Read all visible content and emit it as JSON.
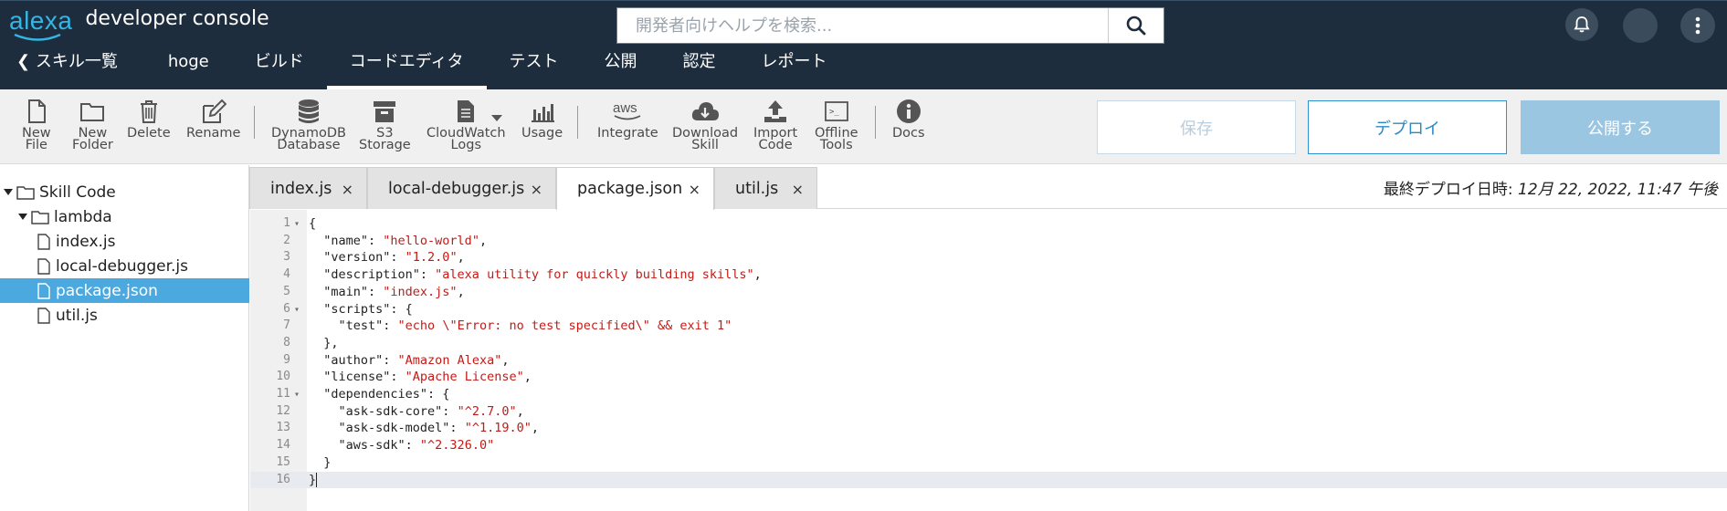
{
  "header": {
    "logo_text": "alexa",
    "app_title": "developer console",
    "search_placeholder": "開発者向けヘルプを検索...",
    "icons": [
      "bell-icon",
      "avatar",
      "kebab-menu-icon"
    ]
  },
  "nav": {
    "back_label": "スキル一覧",
    "items": [
      "hoge",
      "ビルド",
      "コードエディタ",
      "テスト",
      "公開",
      "認定",
      "レポート"
    ],
    "active": "コードエディタ"
  },
  "toolbar": {
    "tools": [
      {
        "label": "New\nFile",
        "icon": "new-file-icon"
      },
      {
        "label": "New\nFolder",
        "icon": "new-folder-icon"
      },
      {
        "label": "Delete",
        "icon": "trash-icon"
      },
      {
        "label": "Rename",
        "icon": "pencil-icon"
      },
      {
        "label": "DynamoDB\nDatabase",
        "icon": "database-icon"
      },
      {
        "label": "S3\nStorage",
        "icon": "storage-icon"
      },
      {
        "label": "CloudWatch\nLogs",
        "icon": "logs-icon"
      },
      {
        "label": "Usage",
        "icon": "bar-chart-icon"
      },
      {
        "label": "Integrate",
        "icon": "aws-icon"
      },
      {
        "label": "Download\nSkill",
        "icon": "cloud-download-icon"
      },
      {
        "label": "Import\nCode",
        "icon": "upload-icon"
      },
      {
        "label": "Offline\nTools",
        "icon": "terminal-icon"
      },
      {
        "label": "Docs",
        "icon": "info-icon"
      }
    ],
    "save_label": "保存",
    "deploy_label": "デプロイ",
    "publish_label": "公開する"
  },
  "tree": {
    "root": "Skill Code",
    "folder": "lambda",
    "files": [
      "index.js",
      "local-debugger.js",
      "package.json",
      "util.js"
    ],
    "selected": "package.json"
  },
  "tabs": {
    "items": [
      "index.js",
      "local-debugger.js",
      "package.json",
      "util.js"
    ],
    "active": "package.json",
    "close_glyph": "×"
  },
  "deploy_info": {
    "label": "最終デプロイ日時:",
    "value": "12月 22, 2022, 11:47 午後"
  },
  "editor": {
    "lines": [
      "{",
      "  \"name\": \"hello-world\",",
      "  \"version\": \"1.2.0\",",
      "  \"description\": \"alexa utility for quickly building skills\",",
      "  \"main\": \"index.js\",",
      "  \"scripts\": {",
      "    \"test\": \"echo \\\"Error: no test specified\\\" && exit 1\"",
      "  },",
      "  \"author\": \"Amazon Alexa\",",
      "  \"license\": \"Apache License\",",
      "  \"dependencies\": {",
      "    \"ask-sdk-core\": \"^2.7.0\",",
      "    \"ask-sdk-model\": \"^1.19.0\",",
      "    \"aws-sdk\": \"^2.326.0\"",
      "  }",
      "}"
    ],
    "fold_lines": [
      1,
      6,
      11
    ],
    "current_line": 16
  }
}
